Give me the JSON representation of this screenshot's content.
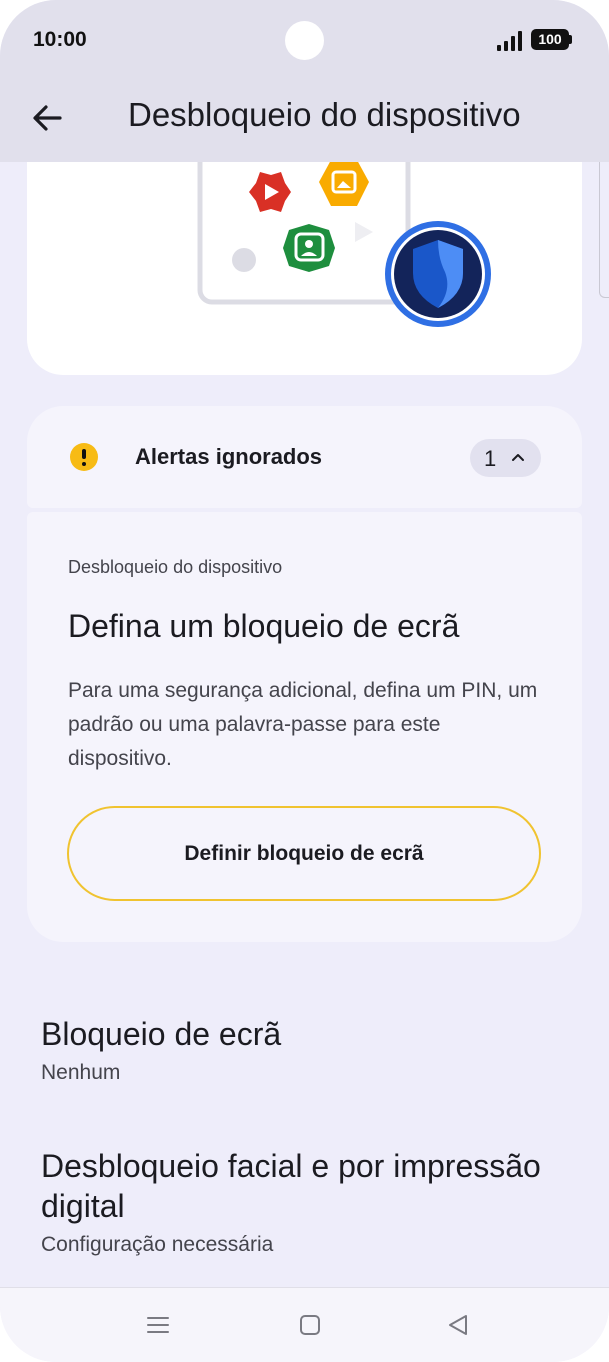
{
  "status_bar": {
    "time": "10:00",
    "battery": "100",
    "icons": [
      "signal-icon",
      "battery-icon"
    ]
  },
  "app_bar": {
    "title": "Desbloqueio do dispositivo",
    "back_icon": "arrow-back-icon"
  },
  "alerts": {
    "title": "Alertas ignorados",
    "count": "1",
    "icon": "warning-icon",
    "item": {
      "category": "Desbloqueio do dispositivo",
      "heading": "Defina um bloqueio de ecrã",
      "description": "Para uma segurança adicional, defina um PIN, um padrão ou uma palavra-passe para este dispositivo.",
      "button_label": "Definir bloqueio de ecrã"
    }
  },
  "settings": [
    {
      "title": "Bloqueio de ecrã",
      "subtitle": "Nenhum"
    },
    {
      "title": "Desbloqueio facial e por impressão digital",
      "subtitle": "Configuração necessária"
    }
  ],
  "nav_bar": {
    "icons": [
      "menu-icon",
      "home-icon",
      "back-triangle-icon"
    ]
  },
  "colors": {
    "background": "#eeedfa",
    "app_bar": "#e1e0ec",
    "card": "#f5f4fc",
    "warning": "#f7bb15",
    "button_border": "#f0c330",
    "shield_blue": "#3b6fe0"
  }
}
